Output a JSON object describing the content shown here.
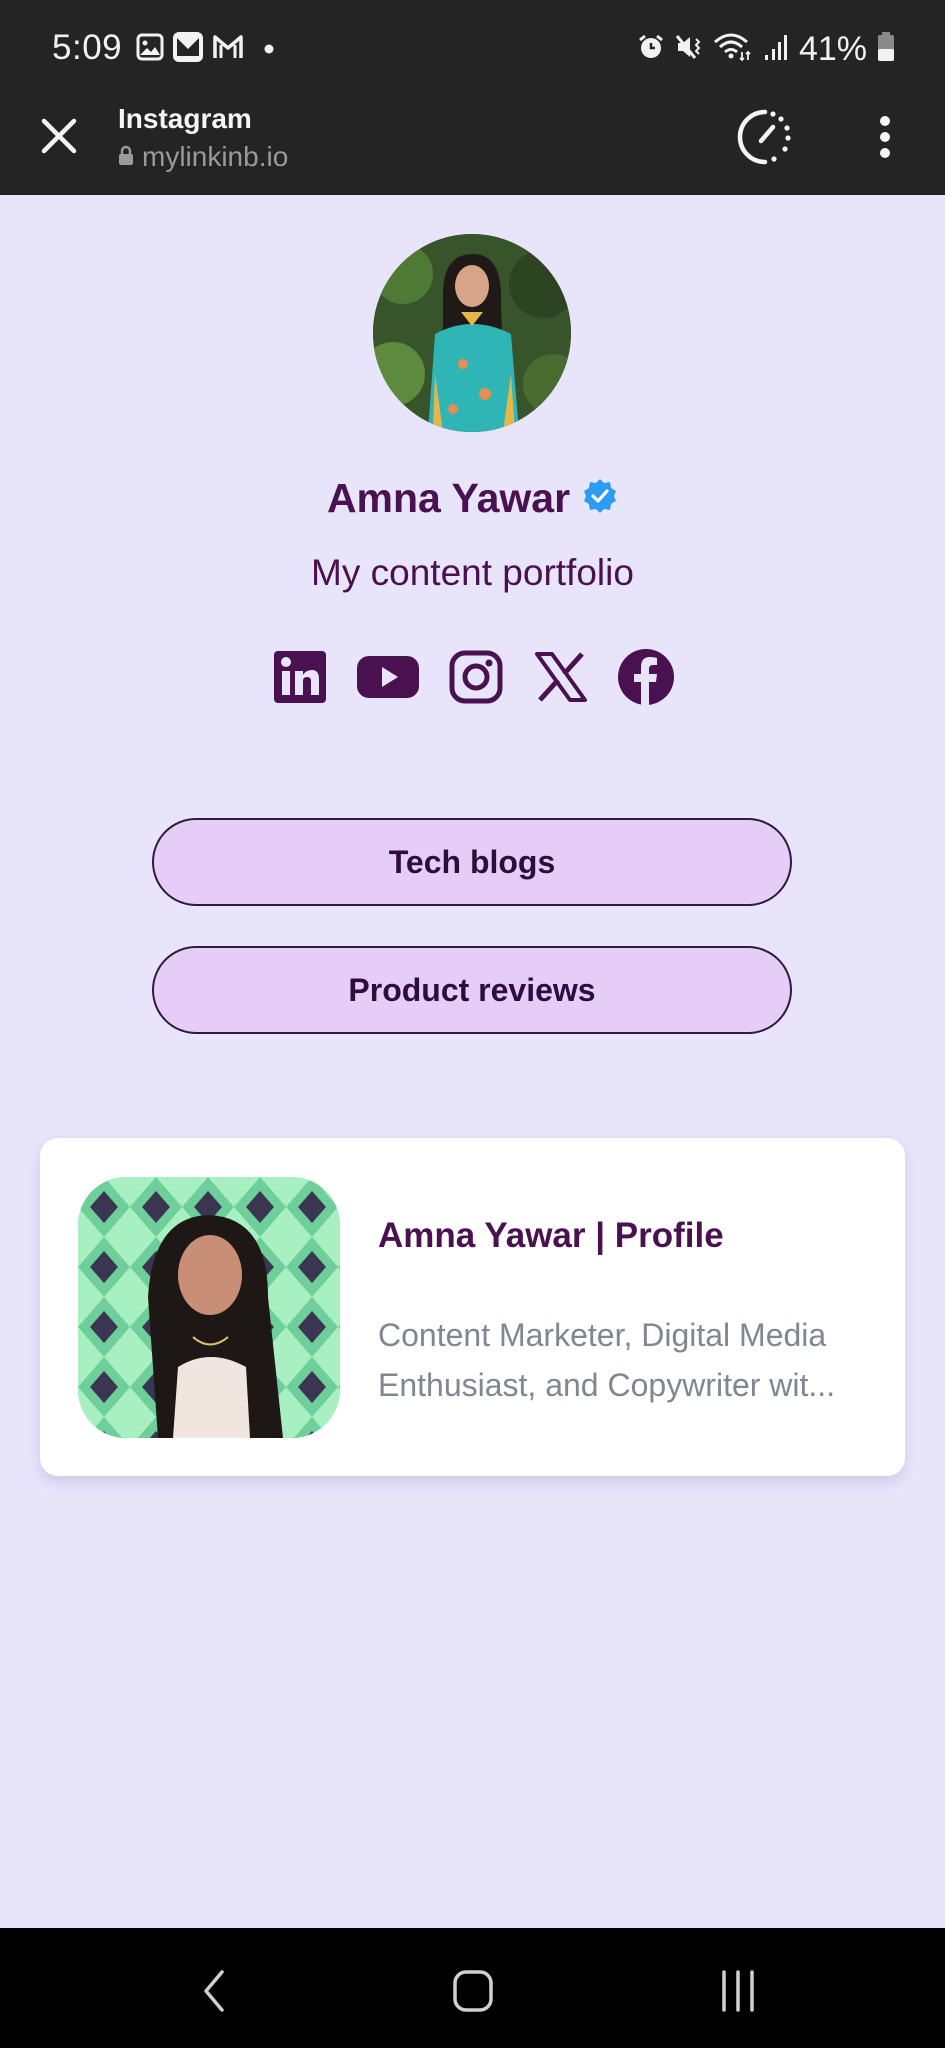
{
  "status_bar": {
    "time": "5:09",
    "left_icons": [
      "gallery-icon",
      "mail-icon",
      "gmail-icon",
      "notification-dot-icon"
    ],
    "right_icons": [
      "alarm-icon",
      "mute-vibrate-icon",
      "wifi-icon",
      "signal-icon"
    ],
    "battery_percent": "41%"
  },
  "browser": {
    "title": "Instagram",
    "url": "mylinkinb.io",
    "close_icon": "close-icon",
    "secure_icon": "lock-icon",
    "speed_icon": "page-speed-icon",
    "menu_icon": "more-vert-icon"
  },
  "profile": {
    "name": "Amna Yawar",
    "verified": true,
    "bio": "My content portfolio",
    "accent_color": "#4a1150",
    "verified_color": "#2b9cf2"
  },
  "socials": [
    {
      "name": "LinkedIn",
      "icon": "linkedin-icon"
    },
    {
      "name": "YouTube",
      "icon": "youtube-icon"
    },
    {
      "name": "Instagram",
      "icon": "instagram-icon"
    },
    {
      "name": "X",
      "icon": "x-icon"
    },
    {
      "name": "Facebook",
      "icon": "facebook-icon"
    }
  ],
  "links": [
    {
      "label": "Tech blogs"
    },
    {
      "label": "Product reviews"
    }
  ],
  "featured_card": {
    "title": "Amna Yawar | Profile",
    "description": "Content Marketer, Digital Media Enthusiast, and Copywriter wit..."
  },
  "nav_bar": {
    "back": "back-icon",
    "home": "home-icon",
    "recents": "recents-icon"
  }
}
